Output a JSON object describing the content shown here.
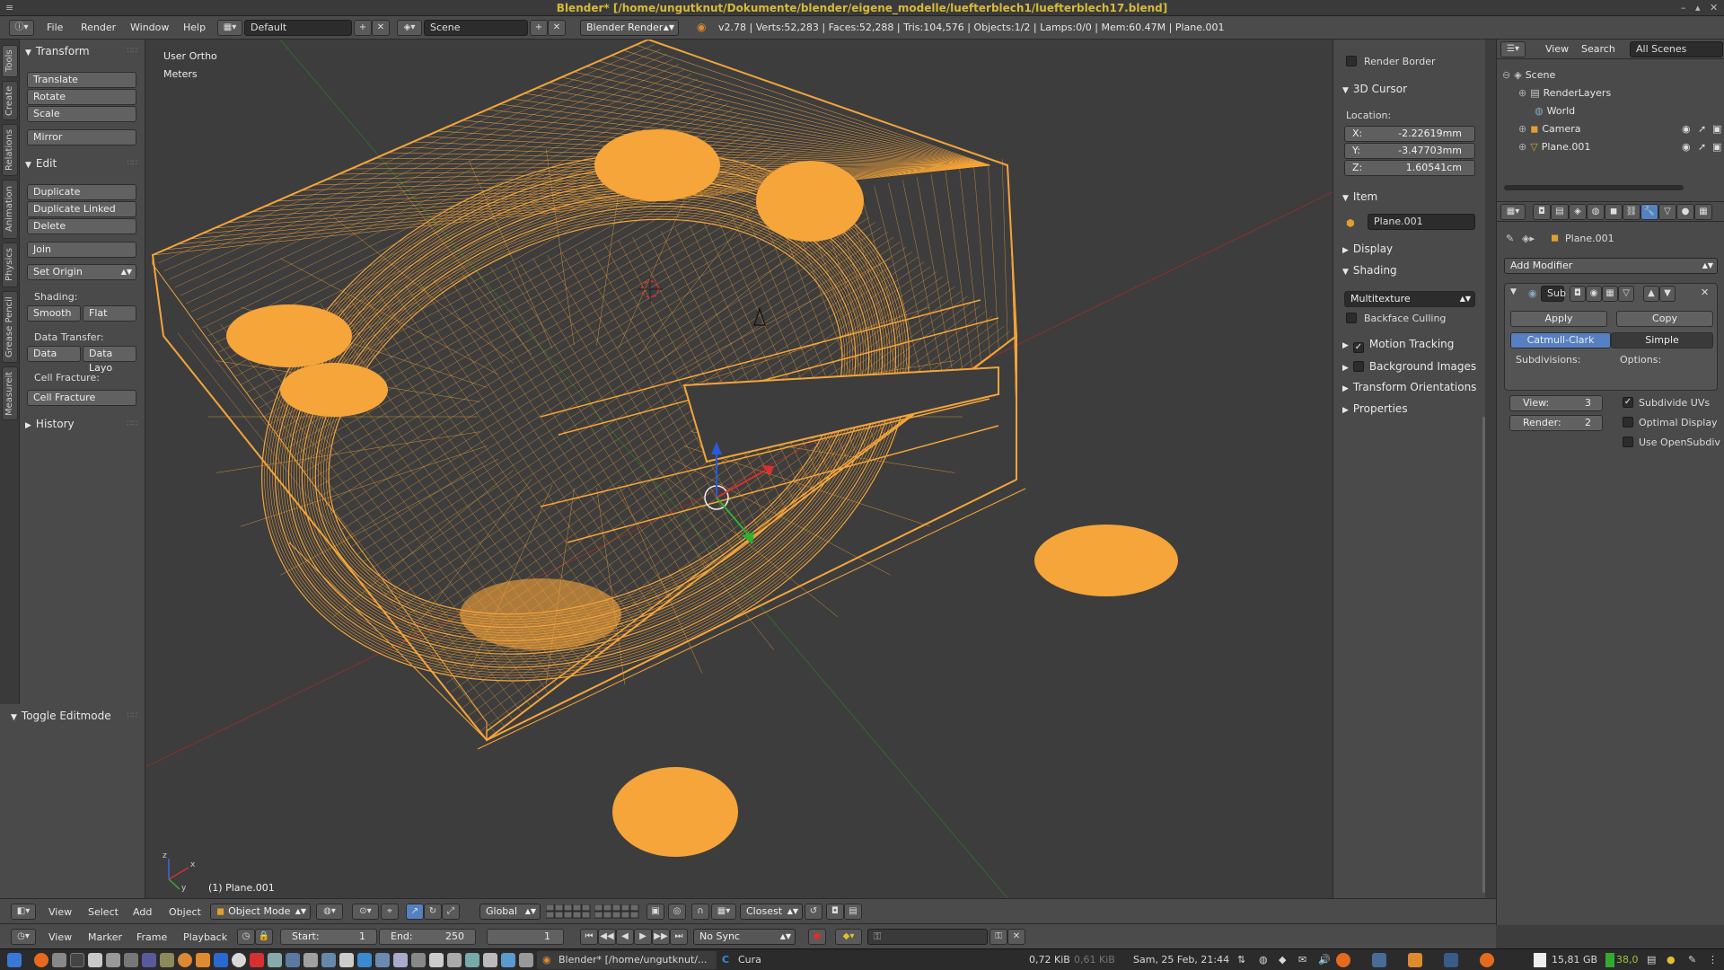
{
  "title_bar": {
    "text": "Blender* [/home/ungutknut/Dokumente/blender/eigene_modelle/luefterblech1/luefterblech17.blend]",
    "min": "–",
    "max": "▴",
    "close": "✕"
  },
  "info_header": {
    "menus": [
      "File",
      "Render",
      "Window",
      "Help"
    ],
    "layout": "Default",
    "scene": "Scene",
    "engine": "Blender Render",
    "stats": "v2.78 | Verts:52,283 | Faces:52,288 | Tris:104,576 | Objects:1/2 | Lamps:0/0 | Mem:60.47M | Plane.001"
  },
  "tool_tabs": [
    "Tools",
    "Create",
    "Relations",
    "Animation",
    "Physics",
    "Grease Pencil",
    "Measureit"
  ],
  "toolshelf": {
    "transform_title": "Transform",
    "transform": [
      "Translate",
      "Rotate",
      "Scale",
      "Mirror"
    ],
    "edit_title": "Edit",
    "edit": [
      "Duplicate",
      "Duplicate Linked",
      "Delete",
      "Join",
      "Set Origin"
    ],
    "shading_label": "Shading:",
    "shading": [
      "Smooth",
      "Flat"
    ],
    "data_transfer_label": "Data Transfer:",
    "data_transfer": [
      "Data",
      "Data Layo"
    ],
    "cell_fracture_label": "Cell Fracture:",
    "cell_fracture": "Cell Fracture",
    "history_title": "History",
    "toggle_editmode": "Toggle Editmode"
  },
  "viewport": {
    "view_name": "User Ortho",
    "units": "Meters",
    "object_label": "(1) Plane.001",
    "axis_z": "z",
    "axis_x": "x",
    "axis_y": "y"
  },
  "npanel": {
    "render_border": "Render Border",
    "cursor_title": "3D Cursor",
    "location_label": "Location:",
    "x_label": "X:",
    "x": "-2.22619mm",
    "y_label": "Y:",
    "y": "-3.47703mm",
    "z_label": "Z:",
    "z": "1.60541cm",
    "item_title": "Item",
    "item_name": "Plane.001",
    "display_title": "Display",
    "shading_title": "Shading",
    "shading_mode": "Multitexture",
    "backface": "Backface Culling",
    "motion_tracking": "Motion Tracking",
    "background_images": "Background Images",
    "transform_orientations": "Transform Orientations",
    "properties": "Properties"
  },
  "outliner": {
    "menus": [
      "View",
      "Search"
    ],
    "filter": "All Scenes",
    "items": [
      "Scene",
      "RenderLayers",
      "World",
      "Camera",
      "Plane.001"
    ]
  },
  "properties_editor": {
    "object_name": "Plane.001",
    "add_modifier": "Add Modifier",
    "modifier_name": "Sub",
    "apply": "Apply",
    "copy": "Copy",
    "catmull": "Catmull-Clark",
    "simple": "Simple",
    "subdivisions_label": "Subdivisions:",
    "options_label": "Options:",
    "view_label": "View:",
    "view_value": "3",
    "render_label": "Render:",
    "render_value": "2",
    "subdivide_uvs": "Subdivide UVs",
    "optimal_display": "Optimal Display",
    "use_opensubdiv": "Use OpenSubdiv"
  },
  "viewport_header": {
    "menus": [
      "View",
      "Select",
      "Add",
      "Object"
    ],
    "mode": "Object Mode",
    "orientation": "Global",
    "snap": "Closest"
  },
  "timeline": {
    "menus": [
      "View",
      "Marker",
      "Frame",
      "Playback"
    ],
    "start_label": "Start:",
    "start": "1",
    "end_label": "End:",
    "end": "250",
    "current": "1",
    "sync": "No Sync"
  },
  "taskbar": {
    "task_blender": "Blender* [/home/ungutknut/...",
    "task_cura": "Cura",
    "net_up": "0,72 KiB",
    "net_down": "0,61 KiB",
    "clock": "Sam, 25 Feb, 21:44",
    "disk": "15,81 GB",
    "temp": "38,0"
  },
  "colors": {
    "wire": "#f6a53a",
    "accent_blue": "#5680c2",
    "title_text": "#d6ba3a"
  }
}
